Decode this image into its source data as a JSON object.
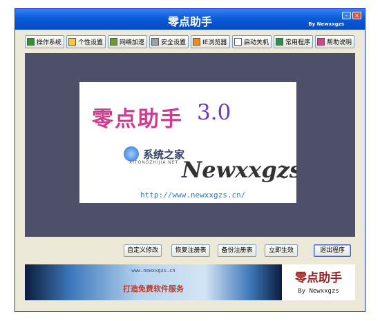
{
  "window": {
    "title": "零点助手",
    "byline": "By  Newxxgzs"
  },
  "toolbar": [
    {
      "label": "操作系统",
      "icon": "system-icon"
    },
    {
      "label": "个性设置",
      "icon": "folder-icon"
    },
    {
      "label": "网络加速",
      "icon": "network-icon"
    },
    {
      "label": "安全设置",
      "icon": "security-icon"
    },
    {
      "label": "IE浏览器",
      "icon": "browser-icon"
    },
    {
      "label": "启动关机",
      "icon": "startup-icon"
    },
    {
      "label": "常用程序",
      "icon": "program-icon"
    },
    {
      "label": "帮助说明",
      "icon": "help-icon"
    }
  ],
  "splash": {
    "title": "零点助手",
    "version": "3.0",
    "site_name": "系统之家",
    "site_pinyin": "XITONGZHIJIA.NET",
    "author": "Newxxgzs",
    "url": "http://www.newxxgzs.cn/"
  },
  "actions": {
    "custom_edit": "自定义修改",
    "restore_registry": "恢复注册表",
    "backup_registry": "备份注册表",
    "apply_now": "立即生效",
    "exit_program": "退出程序"
  },
  "ad_banner": {
    "url": "www.newxxgzs.cn",
    "text": "打造免费软件服务"
  },
  "brand": {
    "title": "零点助手",
    "byline": "By Newxxgzs"
  },
  "colors": {
    "titlebar": "#0a5bd8",
    "canvas_bg": "#4d5068",
    "window_bg": "#ece9d8"
  }
}
